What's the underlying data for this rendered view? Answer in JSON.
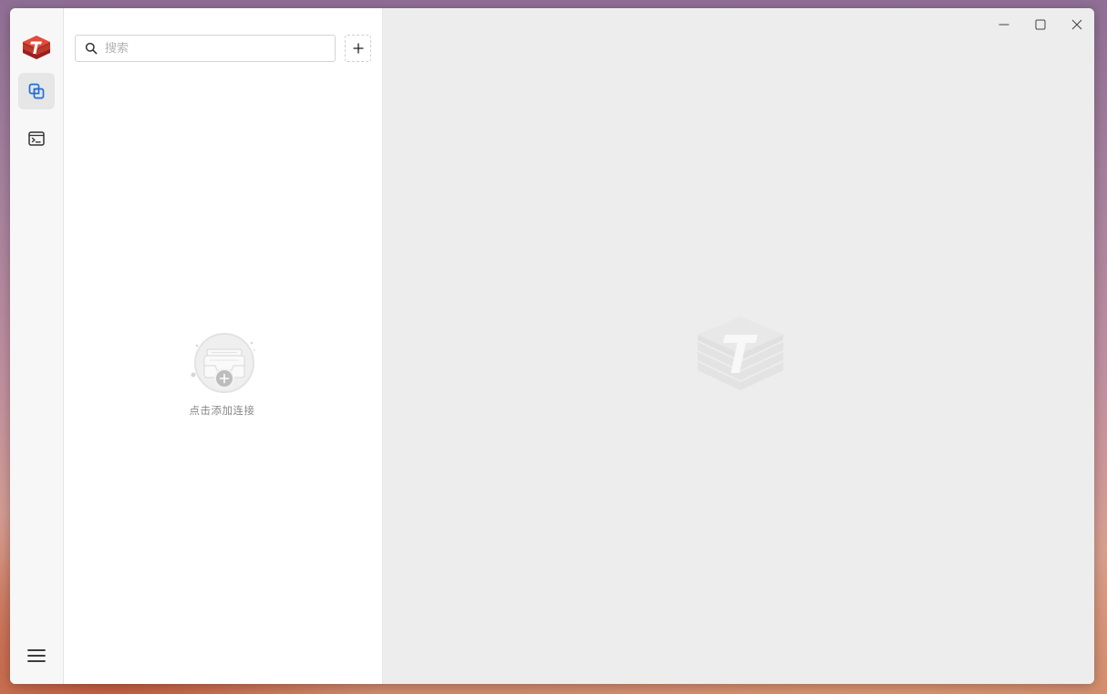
{
  "app": {
    "accent_color": "#1d6fd9",
    "brand_color": "#c9302c"
  },
  "sidebar": {
    "logo_icon": "tiny-rdm-logo-icon",
    "items": [
      {
        "id": "servers",
        "icon": "server-connections-icon",
        "active": true
      },
      {
        "id": "console",
        "icon": "terminal-console-icon",
        "active": false
      }
    ],
    "bottom": {
      "icon": "hamburger-menu-icon"
    }
  },
  "connections_panel": {
    "search": {
      "placeholder": "搜索",
      "value": ""
    },
    "add_button": {
      "icon": "plus-icon"
    },
    "empty_state": {
      "icon": "empty-inbox-add-icon",
      "text": "点击添加连接"
    }
  },
  "main": {
    "watermark_icon": "tiny-rdm-watermark-logo-icon"
  },
  "window_controls": [
    "minimize-icon",
    "maximize-icon",
    "close-icon"
  ]
}
